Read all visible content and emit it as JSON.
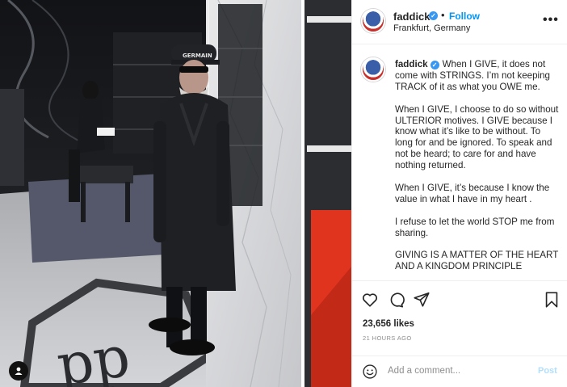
{
  "post": {
    "username": "faddick",
    "follow_label": "Follow",
    "dot": "•",
    "location": "Frankfurt, Germany",
    "more_label": "•••",
    "caption_paragraphs": [
      "When I GIVE, it does not come with STRINGS. I’m not keeping TRACK of it as what you OWE me.",
      "When I GIVE, I choose to do so without ULTERIOR motives. I GIVE because I know what it’s like to be without. To long for and be ignored. To speak and not be heard; to care for and have nothing returned.",
      "When I GIVE, it’s because I know the value in what I have in my heart .",
      "I refuse to let the world STOP me from sharing.",
      "GIVING IS A MATTER OF THE HEART AND A KINGDOM PRINCIPLE"
    ],
    "likes": "23,656 likes",
    "time": "21 HOURS AGO",
    "comment_placeholder": "Add a comment...",
    "post_label": "Post",
    "cap_text": "GERMAIN",
    "floor_logo": "pp"
  },
  "icons": {
    "verified": "verified-badge-icon",
    "more": "more-options-icon",
    "like": "heart-icon",
    "comment": "comment-bubble-icon",
    "share": "paper-plane-icon",
    "save": "bookmark-icon",
    "emoji": "smiley-icon",
    "user_tag": "user-tag-icon"
  },
  "colors": {
    "link_blue": "#0095f6",
    "verified_blue": "#3897f0",
    "muted": "#8e8e8e",
    "post_disabled": "#b2dffc",
    "red_accent": "#e1341e"
  }
}
